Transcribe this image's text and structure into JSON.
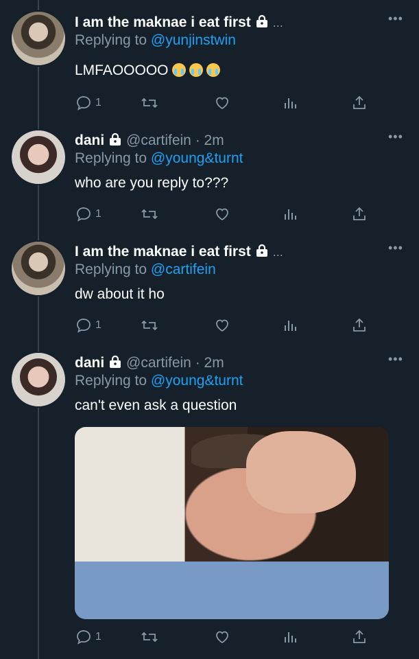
{
  "tweets": [
    {
      "name": "I am the maknae i eat first",
      "handle": "",
      "time": "",
      "protected": true,
      "truncated": "...",
      "reply_prefix": "Replying to",
      "reply_to": "@yunjinstwin",
      "text": "LMFAOOOOO",
      "emoji": [
        "loudly-crying-face",
        "loudly-crying-face",
        "loudly-crying-face"
      ],
      "reply_count": "1"
    },
    {
      "name": "dani",
      "handle": "@cartifein",
      "time": "· 2m",
      "protected": true,
      "reply_prefix": "Replying to",
      "reply_to": "@young&turnt",
      "text": "who are you reply to???",
      "reply_count": "1"
    },
    {
      "name": "I am the maknae i eat first",
      "handle": "",
      "time": "",
      "protected": true,
      "truncated": "...",
      "reply_prefix": "Replying to",
      "reply_to": "@cartifein",
      "text": "dw about it ho",
      "reply_count": "1"
    },
    {
      "name": "dani",
      "handle": "@cartifein",
      "time": "· 2m",
      "protected": true,
      "reply_prefix": "Replying to",
      "reply_to": "@young&turnt",
      "text": "can't even ask a question",
      "media": "photo",
      "reply_count": "1"
    }
  ],
  "more_glyph": "•••",
  "colors": {
    "background": "#15202b",
    "secondary": "#8899a6",
    "accent": "#1da1f2"
  }
}
